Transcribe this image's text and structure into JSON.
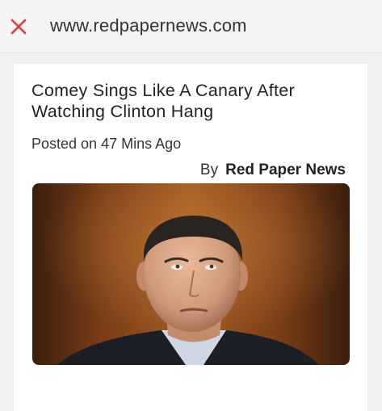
{
  "browser": {
    "url": "www.redpapernews.com",
    "close_icon": "close-x-icon",
    "close_color": "#e53935"
  },
  "article": {
    "headline": "Comey Sings Like A Canary After Watching Clinton Hang",
    "posted_prefix": "Posted on",
    "posted_time": "47 Mins Ago",
    "by_label": "By",
    "author": "Red Paper News",
    "image_alt": "photo of a man in suit looking upward"
  }
}
